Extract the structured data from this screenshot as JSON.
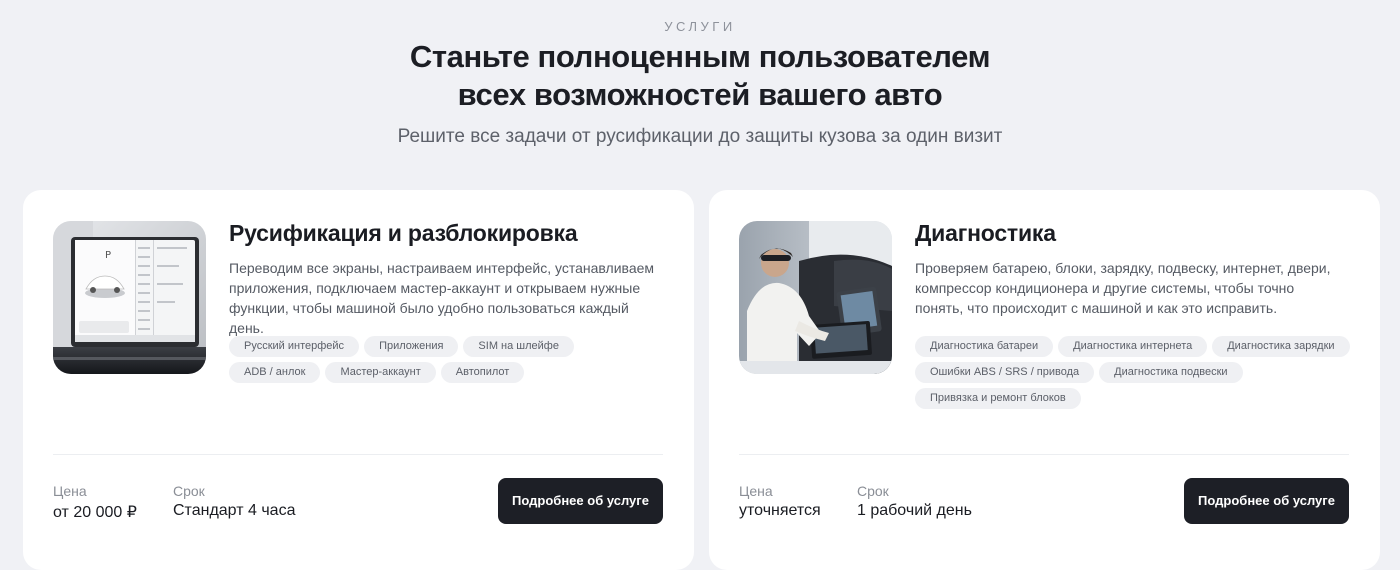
{
  "header": {
    "eyebrow": "УСЛУГИ",
    "title_line1": "Станьте полноценным пользователем",
    "title_line2": "всех возможностей вашего авто",
    "subtitle": "Решите все задачи от русификации до защиты кузова за один визит"
  },
  "cards": [
    {
      "title": "Русификация и разблокировка",
      "description": "Переводим все экраны, настраиваем интерфейс, устанавливаем приложения, подключаем мастер-аккаунт и открываем нужные функции, чтобы машиной было удобно пользоваться каждый день.",
      "tags": [
        "Русский интерфейс",
        "Приложения",
        "SIM на шлейфе",
        "ADB / анлок",
        "Мастер-аккаунт",
        "Автопилот"
      ],
      "price_label": "Цена",
      "price_value": "от 20 000 ₽",
      "term_label": "Срок",
      "term_value": "Стандарт 4 часа",
      "button_label": "Подробнее об услуге",
      "image_icon": "car-infotainment-screen-image",
      "screen_gear": "P"
    },
    {
      "title": "Диагностика",
      "description": "Проверяем батарею, блоки, зарядку, подвеску, интернет, двери, компрессор кондиционера и другие системы, чтобы точно понять, что происходит с машиной и как это исправить.",
      "tags": [
        "Диагностика батареи",
        "Диагностика интернета",
        "Диагностика зарядки",
        "Ошибки ABS / SRS / привода",
        "Диагностика подвески",
        "Привязка и ремонт блоков"
      ],
      "price_label": "Цена",
      "price_value": "уточняется",
      "term_label": "Срок",
      "term_value": "1 рабочий день",
      "button_label": "Подробнее об услуге",
      "image_icon": "technician-diagnostics-photo"
    }
  ],
  "colors": {
    "background": "#f0f1f5",
    "card": "#ffffff",
    "button": "#1d1f26",
    "tag": "#eff0f3"
  }
}
